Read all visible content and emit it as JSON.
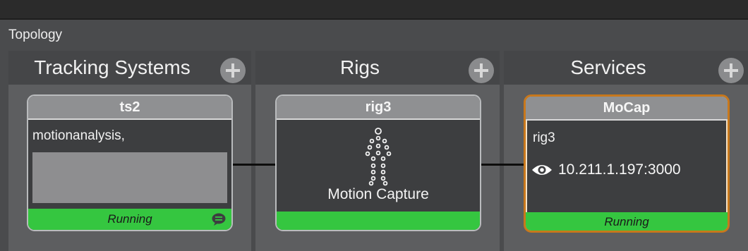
{
  "panel": {
    "title": "Topology"
  },
  "columns": [
    {
      "title": "Tracking Systems",
      "add_icon": "plus-circle-icon"
    },
    {
      "title": "Rigs",
      "add_icon": "plus-circle-icon"
    },
    {
      "title": "Services",
      "add_icon": "plus-circle-icon"
    }
  ],
  "tracking_card": {
    "name": "ts2",
    "description": "motionanalysis,",
    "status": "Running",
    "status_icon": "chat-bubble-icon"
  },
  "rig_card": {
    "name": "rig3",
    "caption": "Motion Capture",
    "icon": "skeleton-figure-icon"
  },
  "service_card": {
    "name": "MoCap",
    "rig": "rig3",
    "address": "10.211.1.197:3000",
    "address_icon": "eye-icon",
    "status": "Running"
  },
  "colors": {
    "running": "#35c640",
    "selected_border": "#c8781c"
  }
}
